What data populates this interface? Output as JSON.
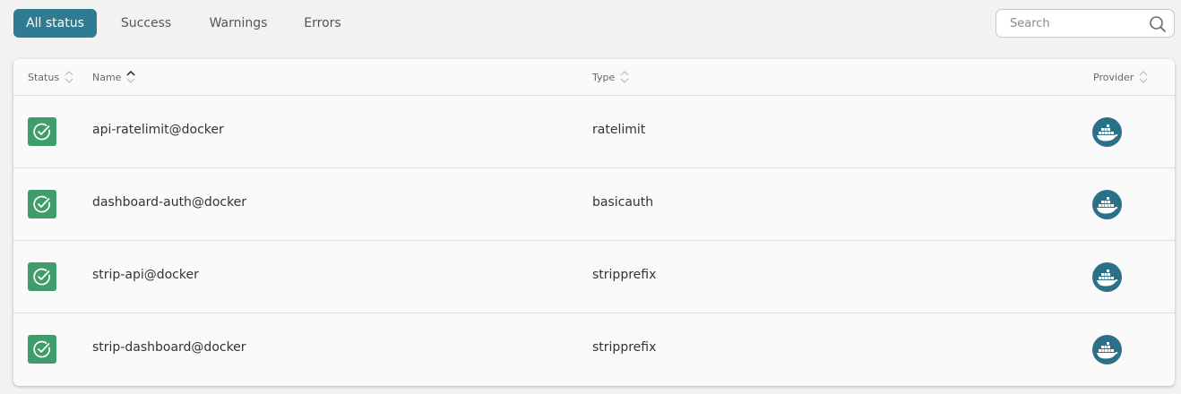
{
  "filters": {
    "tabs": [
      {
        "label": "All status",
        "active": true
      },
      {
        "label": "Success",
        "active": false
      },
      {
        "label": "Warnings",
        "active": false
      },
      {
        "label": "Errors",
        "active": false
      }
    ]
  },
  "search": {
    "placeholder": "Search",
    "value": ""
  },
  "table": {
    "columns": [
      {
        "label": "Status",
        "sort": "none"
      },
      {
        "label": "Name",
        "sort": "ascending"
      },
      {
        "label": "Type",
        "sort": "none"
      },
      {
        "label": "Provider",
        "sort": "none"
      }
    ],
    "rows": [
      {
        "status": "success",
        "name": "api-ratelimit@docker",
        "type": "ratelimit",
        "provider": "docker"
      },
      {
        "status": "success",
        "name": "dashboard-auth@docker",
        "type": "basicauth",
        "provider": "docker"
      },
      {
        "status": "success",
        "name": "strip-api@docker",
        "type": "stripprefix",
        "provider": "docker"
      },
      {
        "status": "success",
        "name": "strip-dashboard@docker",
        "type": "stripprefix",
        "provider": "docker"
      }
    ]
  },
  "colors": {
    "accent": "#2f7c92",
    "success": "#3f9d6b",
    "provider": "#2b7089"
  }
}
